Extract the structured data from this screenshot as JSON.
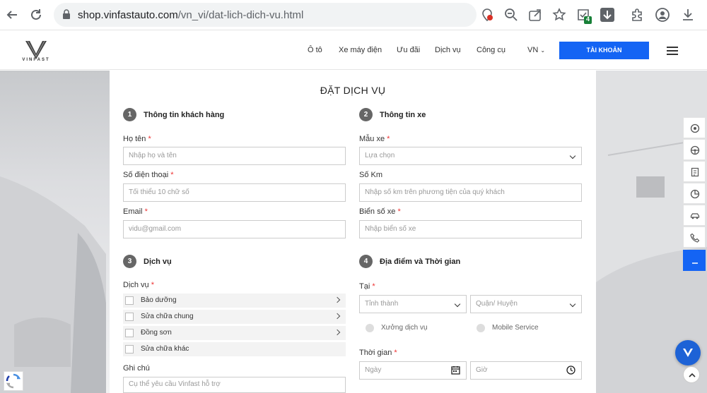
{
  "browser": {
    "url_main": "shop.vinfastauto.com",
    "url_path": "/vn_vi/dat-lich-dich-vu.html",
    "badge_count": "4"
  },
  "header": {
    "brand": "VINFAST",
    "menu": [
      "Ô tô",
      "Xe máy điện",
      "Ưu đãi",
      "Dịch vụ",
      "Công cụ"
    ],
    "language": "VN",
    "account_button": "TÀI KHOẢN"
  },
  "form": {
    "title": "ĐẶT DỊCH VỤ",
    "sections": {
      "customer": {
        "number": "1",
        "title": "Thông tin khách hàng"
      },
      "vehicle": {
        "number": "2",
        "title": "Thông tin xe"
      },
      "service": {
        "number": "3",
        "title": "Dịch vụ"
      },
      "location": {
        "number": "4",
        "title": "Địa điểm và Thời gian"
      }
    },
    "name": {
      "label": "Họ tên",
      "placeholder": "Nhập họ và tên"
    },
    "phone": {
      "label": "Số điện thoại",
      "placeholder": "Tối thiểu 10 chữ số"
    },
    "email": {
      "label": "Email",
      "placeholder": "vidu@gmail.com"
    },
    "model": {
      "label": "Mẫu xe",
      "selected": "Lựa chọn"
    },
    "km": {
      "label": "Số Km",
      "placeholder": "Nhập số km trên phương tiện của quý khách"
    },
    "plate": {
      "label": "Biển số xe",
      "placeholder": "Nhập biển số xe"
    },
    "services_label": "Dịch vụ",
    "services": [
      "Bảo dưỡng",
      "Sửa chữa chung",
      "Đồng sơn",
      "Sửa chữa khác"
    ],
    "note": {
      "label": "Ghi chú",
      "placeholder": "Cụ thể yêu cầu Vinfast hỗ trợ"
    },
    "at_label": "Tại",
    "province": "Tỉnh thành",
    "district": "Quận/ Huyện",
    "radio_options": [
      "Xưởng dịch vụ",
      "Mobile Service"
    ],
    "time_label": "Thời gian",
    "date_placeholder": "Ngày",
    "hour_placeholder": "Giờ"
  },
  "colors": {
    "accent": "#1464f4",
    "step": "#666666"
  }
}
